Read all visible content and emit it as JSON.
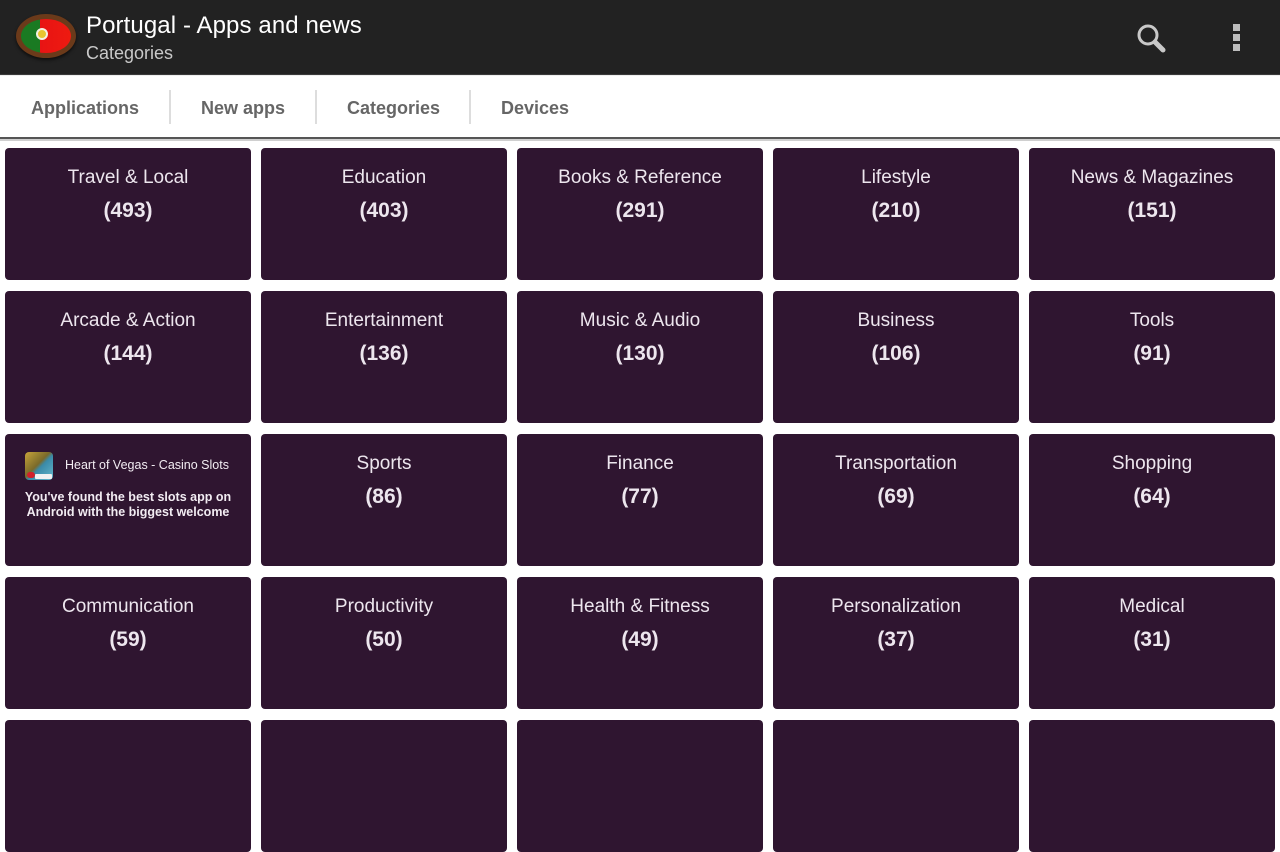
{
  "appbar": {
    "title": "Portugal - Apps and news",
    "subtitle": "Categories",
    "logo_icon": "portugal-flag-icon",
    "actions": [
      {
        "icon": "search-icon",
        "label": "Search"
      },
      {
        "icon": "overflow-menu-icon",
        "label": "More options"
      }
    ]
  },
  "tabs": [
    {
      "label": "Applications"
    },
    {
      "label": "New apps"
    },
    {
      "label": "Categories",
      "selected": true
    },
    {
      "label": "Devices"
    }
  ],
  "grid": {
    "tiles": [
      {
        "type": "category",
        "name": "Travel & Local",
        "count": "(493)"
      },
      {
        "type": "category",
        "name": "Education",
        "count": "(403)"
      },
      {
        "type": "category",
        "name": "Books & Reference",
        "count": "(291)"
      },
      {
        "type": "category",
        "name": "Lifestyle",
        "count": "(210)"
      },
      {
        "type": "category",
        "name": "News & Magazines",
        "count": "(151)"
      },
      {
        "type": "category",
        "name": "Arcade & Action",
        "count": "(144)"
      },
      {
        "type": "category",
        "name": "Entertainment",
        "count": "(136)"
      },
      {
        "type": "category",
        "name": "Music & Audio",
        "count": "(130)"
      },
      {
        "type": "category",
        "name": "Business",
        "count": "(106)"
      },
      {
        "type": "category",
        "name": "Tools",
        "count": "(91)"
      },
      {
        "type": "ad",
        "title": "Heart of Vegas - Casino Slots",
        "body": "You've found the best slots app on Android with the biggest welcome",
        "icon": "heart-of-vegas-app-icon"
      },
      {
        "type": "category",
        "name": "Sports",
        "count": "(86)"
      },
      {
        "type": "category",
        "name": "Finance",
        "count": "(77)"
      },
      {
        "type": "category",
        "name": "Transportation",
        "count": "(69)"
      },
      {
        "type": "category",
        "name": "Shopping",
        "count": "(64)"
      },
      {
        "type": "category",
        "name": "Communication",
        "count": "(59)"
      },
      {
        "type": "category",
        "name": "Productivity",
        "count": "(50)"
      },
      {
        "type": "category",
        "name": "Health & Fitness",
        "count": "(49)"
      },
      {
        "type": "category",
        "name": "Personalization",
        "count": "(37)"
      },
      {
        "type": "category",
        "name": "Medical",
        "count": "(31)"
      },
      {
        "type": "category",
        "name": "",
        "count": ""
      },
      {
        "type": "category",
        "name": "",
        "count": ""
      },
      {
        "type": "category",
        "name": "",
        "count": ""
      },
      {
        "type": "category",
        "name": "",
        "count": ""
      },
      {
        "type": "category",
        "name": "",
        "count": ""
      }
    ]
  },
  "colors": {
    "appbar_bg": "#222222",
    "tile_bg": "#2f1530",
    "tile_text": "#ede6ee",
    "tab_text": "#666666"
  }
}
